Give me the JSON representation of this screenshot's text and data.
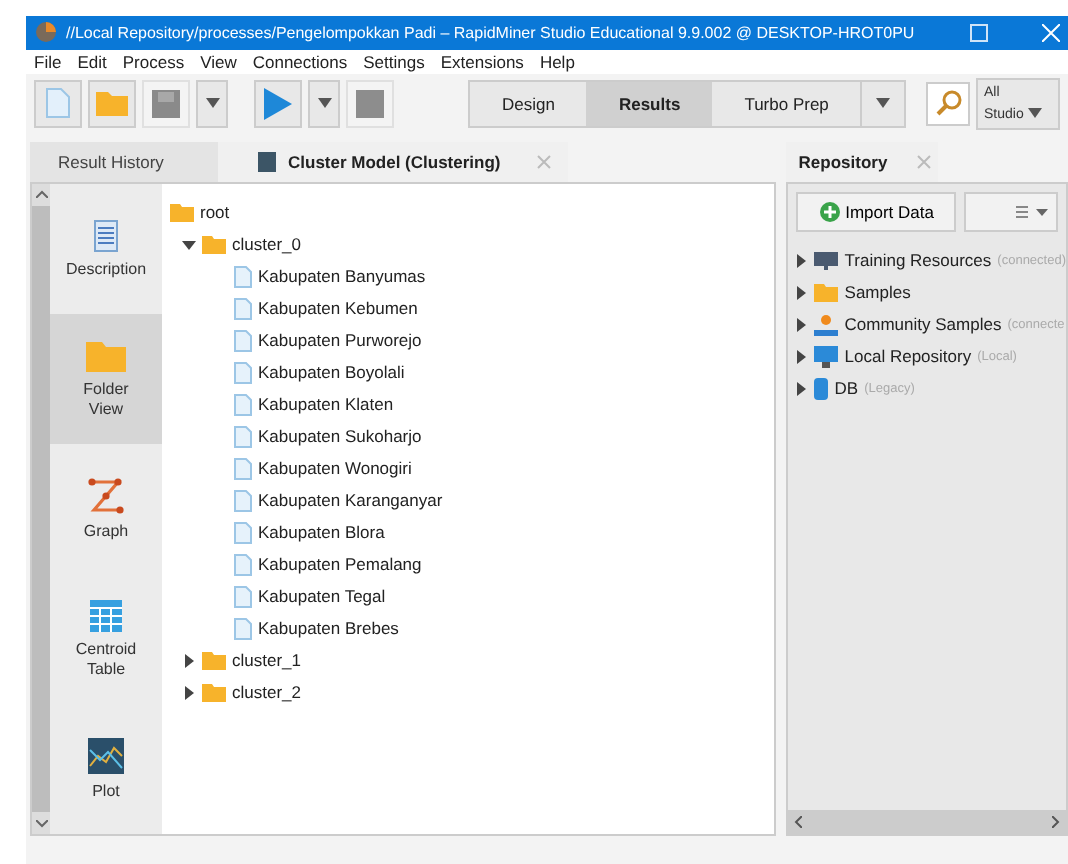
{
  "window": {
    "title": "//Local Repository/processes/Pengelompokkan Padi – RapidMiner Studio Educational 9.9.002 @ DESKTOP-HROT0PU"
  },
  "menu": [
    "File",
    "Edit",
    "Process",
    "View",
    "Connections",
    "Settings",
    "Extensions",
    "Help"
  ],
  "toolbar": {
    "buttons": [
      {
        "kind": "new",
        "disabled": false
      },
      {
        "kind": "open",
        "disabled": false
      },
      {
        "kind": "save",
        "disabled": true
      },
      {
        "kind": "dropdown",
        "disabled": false
      },
      {
        "kind": "run",
        "disabled": false
      },
      {
        "kind": "dropdown",
        "disabled": false
      },
      {
        "kind": "stop",
        "disabled": true
      }
    ],
    "perspectives": [
      {
        "label": "Design",
        "selected": false
      },
      {
        "label": "Results",
        "selected": true
      },
      {
        "label": "Turbo Prep",
        "selected": false
      }
    ],
    "scope": {
      "line_1": "All",
      "line_2": "Studio"
    }
  },
  "results": {
    "tabs": [
      {
        "label": "Result History",
        "selected": false,
        "kind": "plain"
      },
      {
        "label": "Cluster Model (Clustering)",
        "selected": true,
        "kind": "model"
      }
    ],
    "views": [
      {
        "label": "Description",
        "kind": "description",
        "selected": false
      },
      {
        "label": "Folder View",
        "kind": "folder",
        "selected": true
      },
      {
        "label": "Graph",
        "kind": "graph",
        "selected": false
      },
      {
        "label": "Centroid Table",
        "kind": "table",
        "selected": false
      },
      {
        "label": "Plot",
        "kind": "plot",
        "selected": false
      }
    ],
    "tree": [
      {
        "label": "root",
        "kind": "folder",
        "children": [
          {
            "label": "cluster_0",
            "kind": "folder",
            "expanded": true,
            "children": [
              {
                "label": "Kabupaten Banyumas",
                "kind": "file"
              },
              {
                "label": "Kabupaten Kebumen",
                "kind": "file"
              },
              {
                "label": "Kabupaten Purworejo",
                "kind": "file"
              },
              {
                "label": "Kabupaten Boyolali",
                "kind": "file"
              },
              {
                "label": "Kabupaten Klaten",
                "kind": "file"
              },
              {
                "label": "Kabupaten Sukoharjo",
                "kind": "file"
              },
              {
                "label": "Kabupaten Wonogiri",
                "kind": "file"
              },
              {
                "label": "Kabupaten Karanganyar",
                "kind": "file"
              },
              {
                "label": "Kabupaten Blora",
                "kind": "file"
              },
              {
                "label": "Kabupaten Pemalang",
                "kind": "file"
              },
              {
                "label": "Kabupaten Tegal",
                "kind": "file"
              },
              {
                "label": "Kabupaten Brebes",
                "kind": "file"
              }
            ]
          },
          {
            "label": "cluster_1",
            "kind": "folder",
            "expanded": false
          },
          {
            "label": "cluster_2",
            "kind": "folder",
            "expanded": false
          }
        ]
      }
    ]
  },
  "repository": {
    "title": "Repository",
    "import_button": "Import Data",
    "items": [
      {
        "label": "Training Resources",
        "note": "(connected)",
        "kind": "training",
        "expanded": false
      },
      {
        "label": "Samples",
        "kind": "samples",
        "expanded": false
      },
      {
        "label": "Community Samples",
        "note": "(connecte",
        "kind": "community",
        "expanded": false
      },
      {
        "label": "Local Repository",
        "note": "(Local)",
        "kind": "local",
        "expanded": false
      },
      {
        "label": "DB",
        "note": "(Legacy)",
        "kind": "db",
        "expanded": false
      }
    ]
  }
}
